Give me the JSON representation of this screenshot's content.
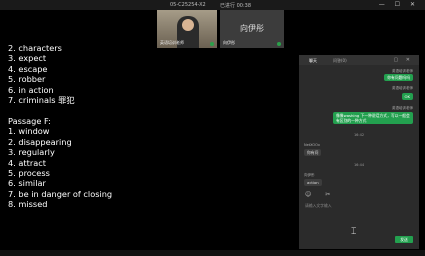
{
  "topbar": {
    "meeting_id": "05-C25254-X2",
    "timer": "已进行 00:38",
    "window_controls": [
      "—",
      "☐",
      "✕"
    ]
  },
  "video": {
    "tile1_name": "英语培训老师",
    "tile2_big_name": "向伊彤",
    "tile2_name": "向伊彤"
  },
  "whiteboard": {
    "lines": [
      "2. characters",
      "3. expect",
      "4. escape",
      "5. robber",
      "6. in action",
      "7. criminals 罪犯",
      "",
      "Passage F:",
      "1. window",
      "2. disappearing",
      "3. regularly",
      "4. attract",
      "5. process",
      "6. similar",
      "7. be in danger of closing",
      "8. missed"
    ]
  },
  "chat": {
    "tabs": [
      "聊天",
      "问答(0)"
    ],
    "tab_icons": [
      "▢",
      "✕"
    ],
    "messages": [
      {
        "sender": "英语培训老师",
        "text": "你有问题吗吗"
      },
      {
        "sender": "英语培训老师",
        "text": "OK"
      },
      {
        "sender": "英语培训老师",
        "text": "像像washing 下一种说话方式，写以一般会有区别的一种方式"
      }
    ],
    "timestamp1": "16:42",
    "student1_name": "NetXOOx",
    "student1_msg": "你有问",
    "timestamp2": "16:44",
    "student2_name": "向伊彤",
    "student2_msg": "action",
    "input_icons": [
      "☺",
      "✂"
    ],
    "input_placeholder": "请输入文字输入",
    "send_label": "发送"
  }
}
